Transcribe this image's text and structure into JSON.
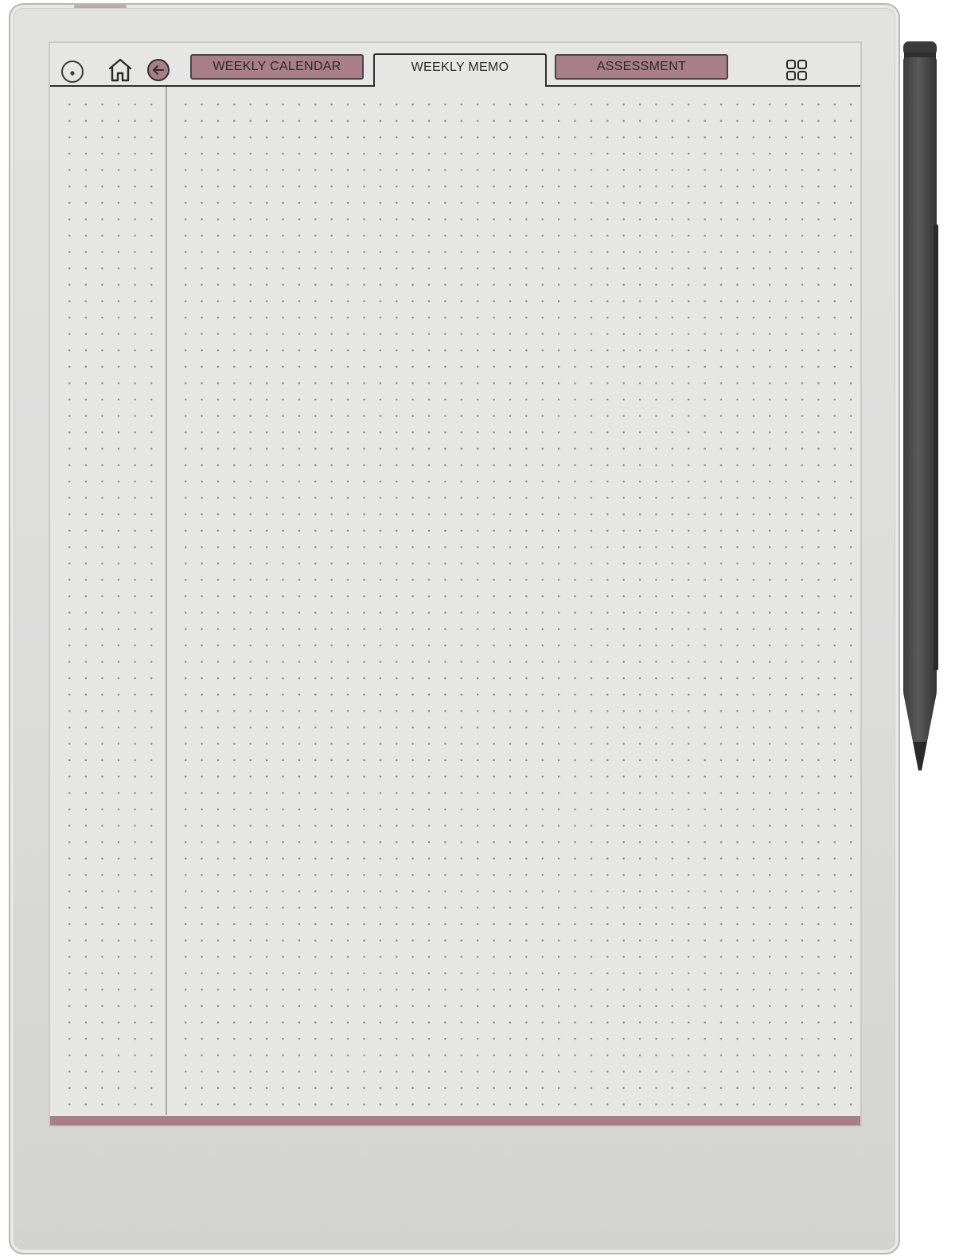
{
  "tabs": [
    {
      "label": "WEEKLY CALENDAR",
      "state": "inactive"
    },
    {
      "label": "WEEKLY MEMO",
      "state": "active"
    },
    {
      "label": "ASSESSMENT",
      "state": "inactive"
    }
  ],
  "icons": {
    "status": "circle-dot-icon",
    "home": "home-icon",
    "back": "arrow-left-circle-icon",
    "grid": "grid-four-squares-icon"
  },
  "colors": {
    "accent": "#a87f89",
    "screen": "#e6e7e5",
    "ink": "#2e2e2e",
    "dots": "#8e8a8c",
    "stylus": "#4a4a4a"
  }
}
